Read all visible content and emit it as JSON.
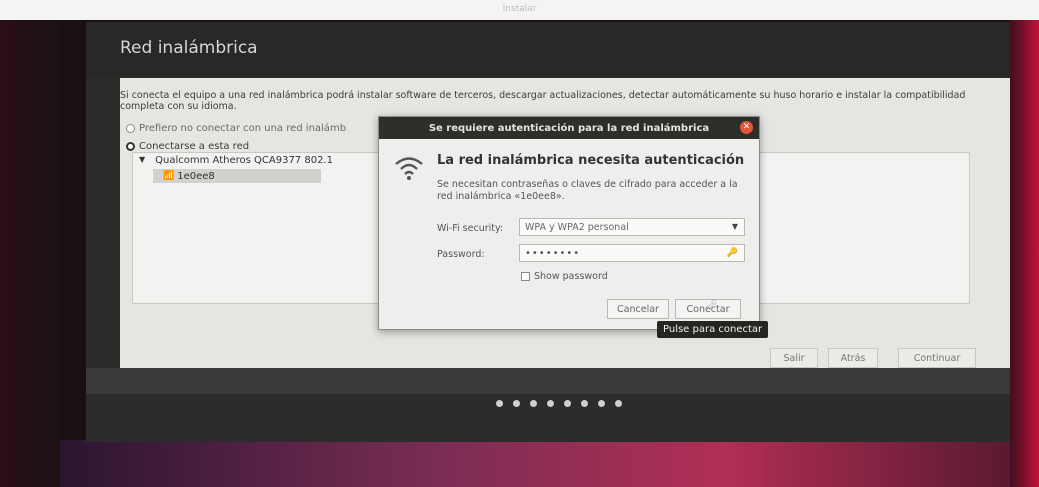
{
  "window": {
    "top_title": "Instalar",
    "title": "Red inalámbrica"
  },
  "content": {
    "intro": "Si conecta el equipo a una red inalámbrica podrá instalar software de terceros, descargar actualizaciones, detectar automáticamente su huso horario e instalar la compatibilidad completa con su idioma.",
    "radio_no_connect": "Prefiero no conectar con una red inalámb",
    "radio_connect": "Conectarse a esta red",
    "adapter": "Qualcomm Atheros QCA9377 802.1",
    "network": "1e0ee8"
  },
  "buttons": {
    "quit": "Salir",
    "back": "Atrás",
    "continue": "Continuar"
  },
  "dialog": {
    "title": "Se requiere autenticación para la red inalámbrica",
    "heading": "La red inalámbrica necesita autenticación",
    "description": "Se necesitan contraseñas o claves de cifrado para acceder a la red inalámbrica «1e0ee8».",
    "wifi_security_label": "Wi-Fi security:",
    "wifi_security_value": "WPA y WPA2 personal",
    "password_label": "Password:",
    "password_value": "••••••••",
    "show_password": "Show password",
    "cancel": "Cancelar",
    "connect": "Conectar"
  },
  "tooltip": "Pulse para conectar",
  "progress": {
    "total_steps": 8
  },
  "icons": [
    "wifi-icon",
    "key-icon",
    "close-icon",
    "chevron-down-icon",
    "cursor-icon"
  ]
}
